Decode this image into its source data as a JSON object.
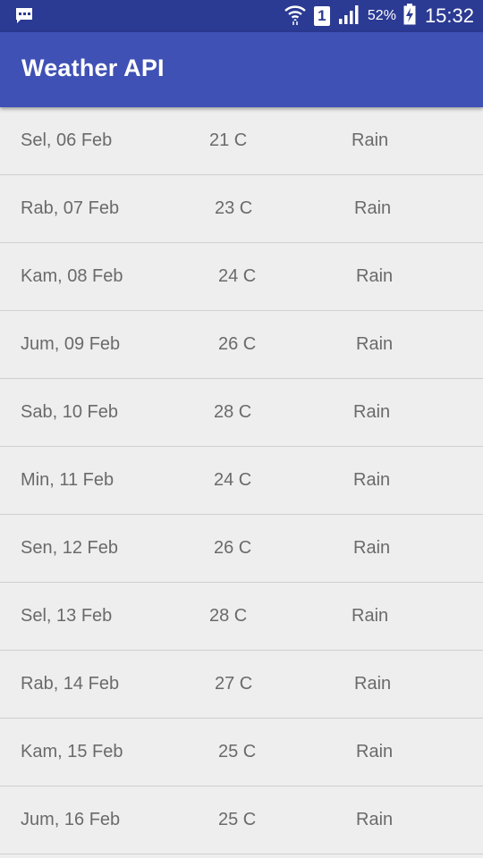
{
  "status_bar": {
    "notification_icon": "message-icon",
    "wifi_icon": "wifi-icon",
    "sim_label": "1",
    "signal_icon": "signal-icon",
    "battery_percent": "52%",
    "battery_icon": "battery-charging-icon",
    "time": "15:32",
    "background": "#2b3a93"
  },
  "app_bar": {
    "title": "Weather API",
    "background": "#3f51b5"
  },
  "forecast": [
    {
      "date": "Sel, 06 Feb",
      "temp": "21 C",
      "condition": "Rain"
    },
    {
      "date": "Rab, 07 Feb",
      "temp": "23 C",
      "condition": "Rain"
    },
    {
      "date": "Kam, 08 Feb",
      "temp": "24 C",
      "condition": "Rain"
    },
    {
      "date": "Jum, 09 Feb",
      "temp": "26 C",
      "condition": "Rain"
    },
    {
      "date": "Sab, 10 Feb",
      "temp": "28 C",
      "condition": "Rain"
    },
    {
      "date": "Min, 11 Feb",
      "temp": "24 C",
      "condition": "Rain"
    },
    {
      "date": "Sen, 12 Feb",
      "temp": "26 C",
      "condition": "Rain"
    },
    {
      "date": "Sel, 13 Feb",
      "temp": "28 C",
      "condition": "Rain"
    },
    {
      "date": "Rab, 14 Feb",
      "temp": "27 C",
      "condition": "Rain"
    },
    {
      "date": "Kam, 15 Feb",
      "temp": "25 C",
      "condition": "Rain"
    },
    {
      "date": "Jum, 16 Feb",
      "temp": "25 C",
      "condition": "Rain"
    }
  ]
}
